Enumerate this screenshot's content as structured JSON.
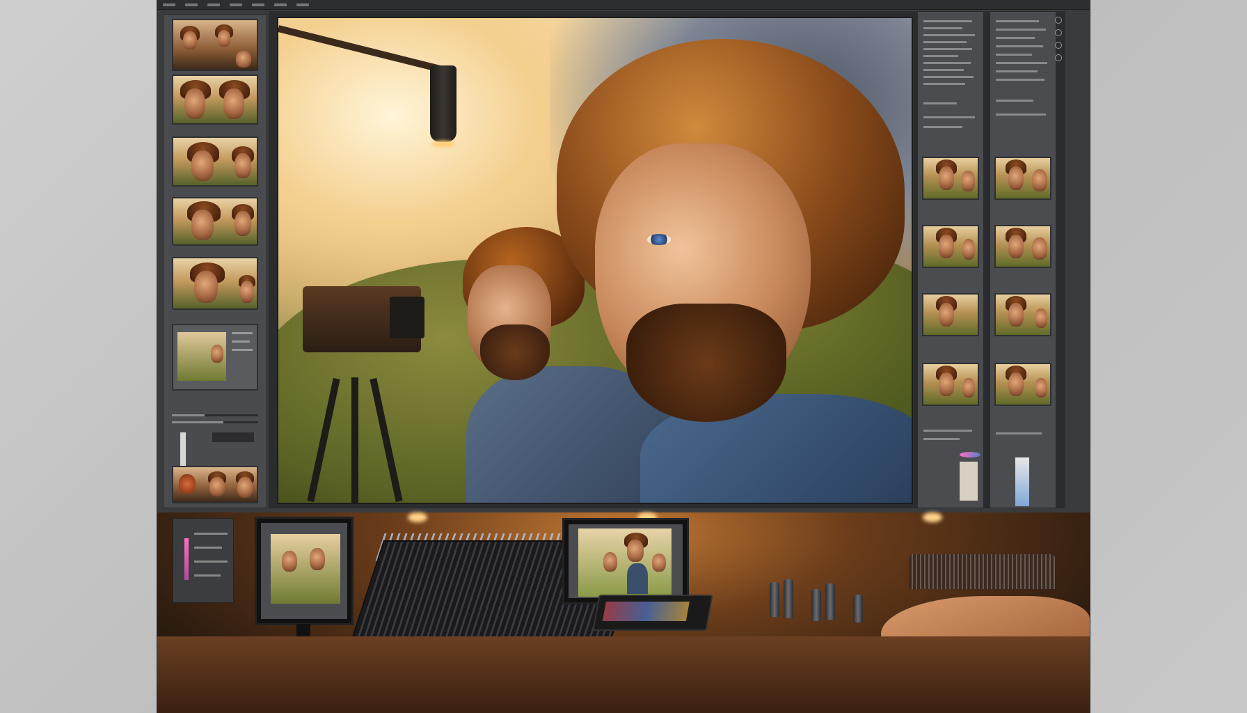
{
  "window": {
    "menu": [
      "",
      "",
      "",
      "",
      "",
      "",
      ""
    ]
  },
  "left_panel": {
    "thumbnail_count": 6,
    "section_labels": [
      "",
      ""
    ]
  },
  "right_panel": {
    "column_1_thumbs": 4,
    "column_2_thumbs": 4
  },
  "colors": {
    "app_background": "#3a3b3d",
    "panel": "#4a4b4e",
    "accent_pink": "#ff6fbf",
    "accent_blue": "#5b7dc9"
  },
  "icons": [
    "scroll-icon",
    "circle-tool-icon",
    "grid-icon"
  ]
}
